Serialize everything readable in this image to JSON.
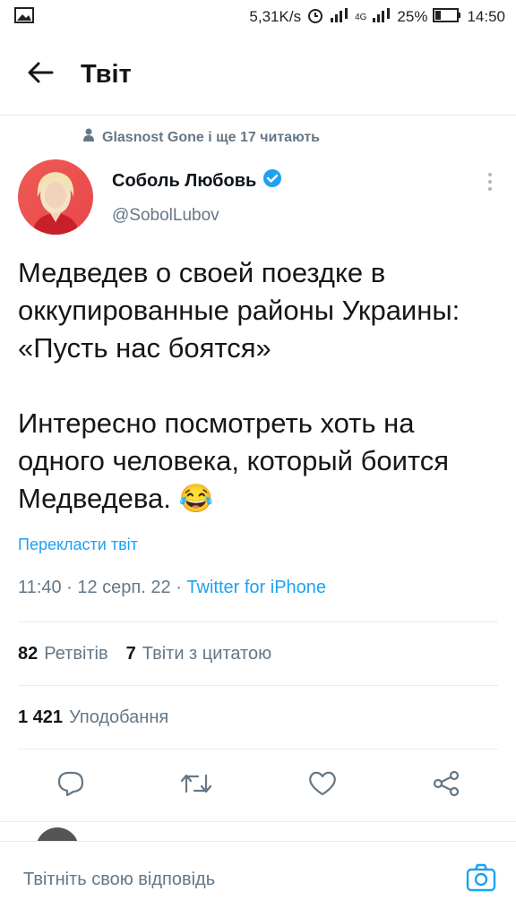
{
  "status_bar": {
    "speed": "5,31K/s",
    "network": "4G",
    "battery": "25%",
    "time": "14:50"
  },
  "header": {
    "title": "Твіт"
  },
  "social_context": "Glasnost Gone і ще 17 читають",
  "author": {
    "name": "Соболь Любовь",
    "handle": "@SobolLubov"
  },
  "tweet": {
    "paragraph1": "Медведев о своей поездке в оккупированные районы Украины: «Пусть нас боятся»",
    "paragraph2": "Интересно посмотреть хоть на одного человека, который боится Медведева.",
    "emoji": "😂",
    "translate": "Перекласти твіт",
    "time": "11:40",
    "sep1": "·",
    "date": "12 серп. 22",
    "sep2": "·",
    "source": "Twitter for iPhone"
  },
  "stats": {
    "retweets_count": "82",
    "retweets_label": "Ретвітів",
    "quotes_count": "7",
    "quotes_label": "Твіти з цитатою",
    "likes_count": "1 421",
    "likes_label": "Уподобання"
  },
  "compose": {
    "placeholder": "Твітніть свою відповідь"
  },
  "colors": {
    "accent": "#1da1f2",
    "secondary_text": "#657786",
    "divider": "#e6ecf0",
    "verified": "#1da1f2"
  },
  "icons": [
    "image-icon",
    "alarm-icon",
    "signal-icon",
    "battery-icon",
    "back-arrow-icon",
    "person-icon",
    "verified-badge-icon",
    "more-vertical-icon",
    "reply-icon",
    "retweet-icon",
    "like-icon",
    "share-icon",
    "camera-icon"
  ]
}
